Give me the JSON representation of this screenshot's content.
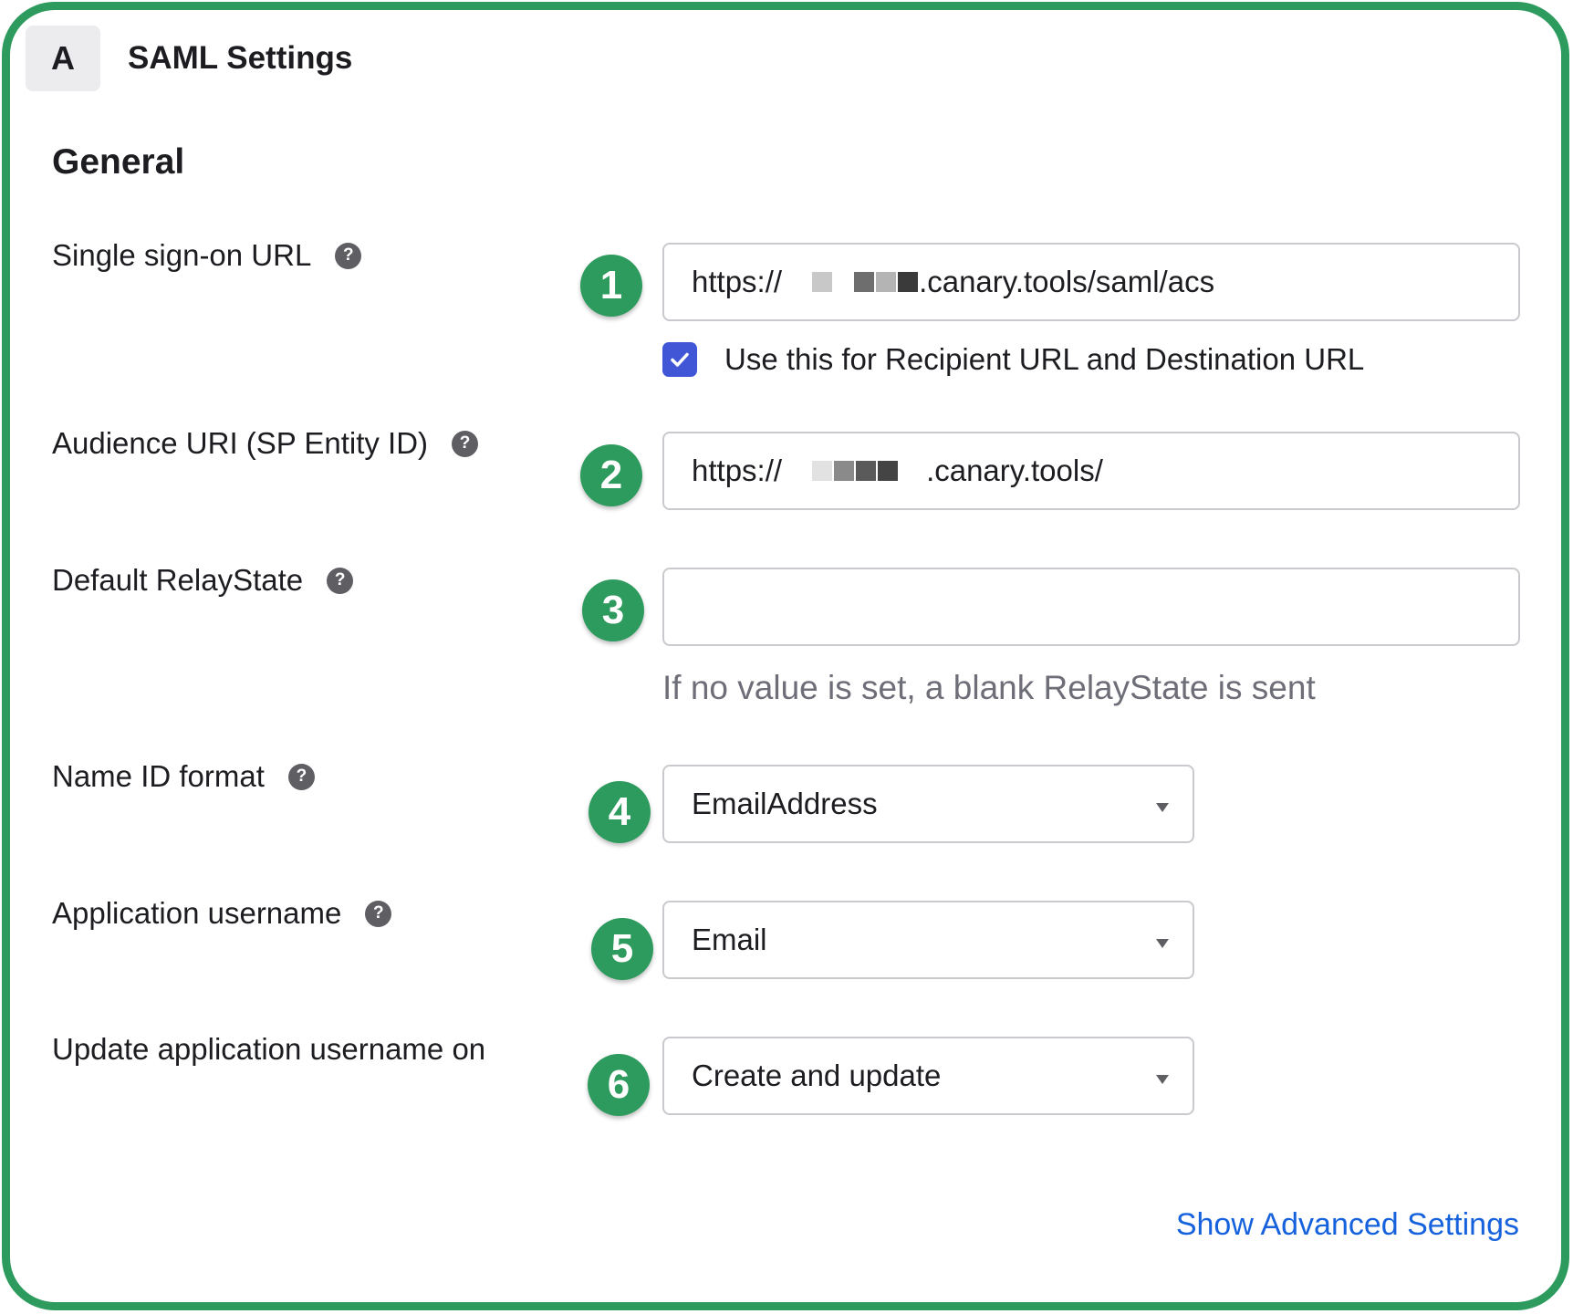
{
  "header": {
    "step_badge": "A",
    "title": "SAML Settings"
  },
  "section_title": "General",
  "help_glyph": "?",
  "rows": [
    {
      "step": "1",
      "label": "Single sign-on URL",
      "has_help": true,
      "value_prefix": "https://",
      "value_suffix": ".canary.tools/saml/acs",
      "redacted": true
    },
    {
      "step": "2",
      "label": "Audience URI (SP Entity ID)",
      "has_help": true,
      "value_prefix": "https://",
      "value_suffix": ".canary.tools/",
      "redacted": true
    },
    {
      "step": "3",
      "label": "Default RelayState",
      "has_help": true,
      "value": "",
      "hint": "If no value is set, a blank RelayState is sent"
    },
    {
      "step": "4",
      "label": "Name ID format",
      "has_help": true,
      "selected": "EmailAddress"
    },
    {
      "step": "5",
      "label": "Application username",
      "has_help": true,
      "selected": "Email"
    },
    {
      "step": "6",
      "label": "Update application username on",
      "has_help": false,
      "selected": "Create and update"
    }
  ],
  "checkbox": {
    "label": "Use this for Recipient URL and Destination URL",
    "checked": true
  },
  "advanced_link": "Show Advanced Settings",
  "colors": {
    "accent_green": "#2e9b5e",
    "checkbox_blue": "#4056d6",
    "link_blue": "#1662dd"
  },
  "icons": {
    "help": "help-icon",
    "check": "checkmark-icon",
    "dropdown": "dropdown-caret-icon"
  }
}
